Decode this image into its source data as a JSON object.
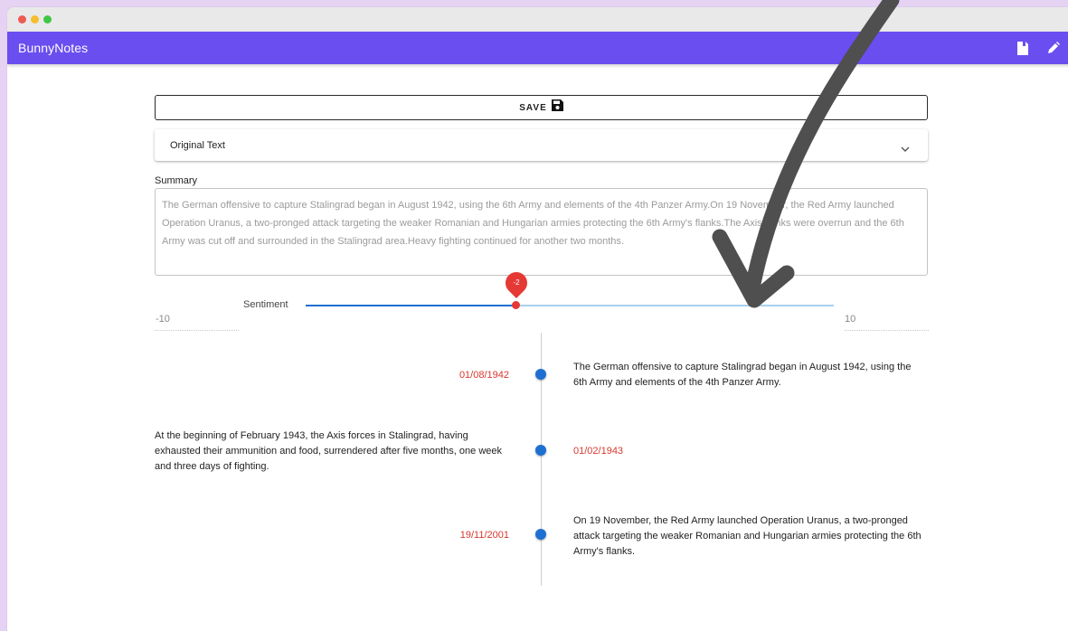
{
  "app": {
    "title": "BunnyNotes"
  },
  "toolbar": {
    "save_label": "SAVE"
  },
  "original_text": {
    "label": "Original Text"
  },
  "summary": {
    "label": "Summary",
    "text": "The German offensive to capture Stalingrad began in August 1942, using the 6th Army and elements of the 4th Panzer Army.On 19 November, the Red Army launched Operation Uranus, a two-pronged attack targeting the weaker Romanian and Hungarian armies protecting the 6th Army's flanks.The Axis flanks were overrun and the 6th Army was cut off and surrounded in the Stalingrad area.Heavy fighting continued for another two months."
  },
  "sentiment": {
    "label": "Sentiment",
    "min": "-10",
    "max": "10",
    "value": "-2",
    "numeric_value": -2
  },
  "timeline": [
    {
      "date": "01/08/1942",
      "text": "The German offensive to capture Stalingrad began in August 1942, using the 6th Army and elements of the 4th Panzer Army."
    },
    {
      "date": "01/02/1943",
      "text": "At the beginning of February 1943, the Axis forces in Stalingrad, having exhausted their ammunition and food, surrendered after five months, one week and three days of fighting."
    },
    {
      "date": "19/11/2001",
      "text": "On 19 November, the Red Army launched Operation Uranus, a two-pronged attack targeting the weaker Romanian and Hungarian armies protecting the 6th Army's flanks."
    }
  ],
  "icons": {
    "appbar": [
      "notebook-icon",
      "pencil-icon"
    ],
    "save": "floppy-disk-icon",
    "accordion": "chevron-down-icon",
    "annotation": "curved-arrow-icon"
  },
  "colors": {
    "appbar": "#6a4eef",
    "accent": "#1e6fd2",
    "date": "#d9382f",
    "thumb": "#e53935",
    "background": "#e6d3f3"
  }
}
